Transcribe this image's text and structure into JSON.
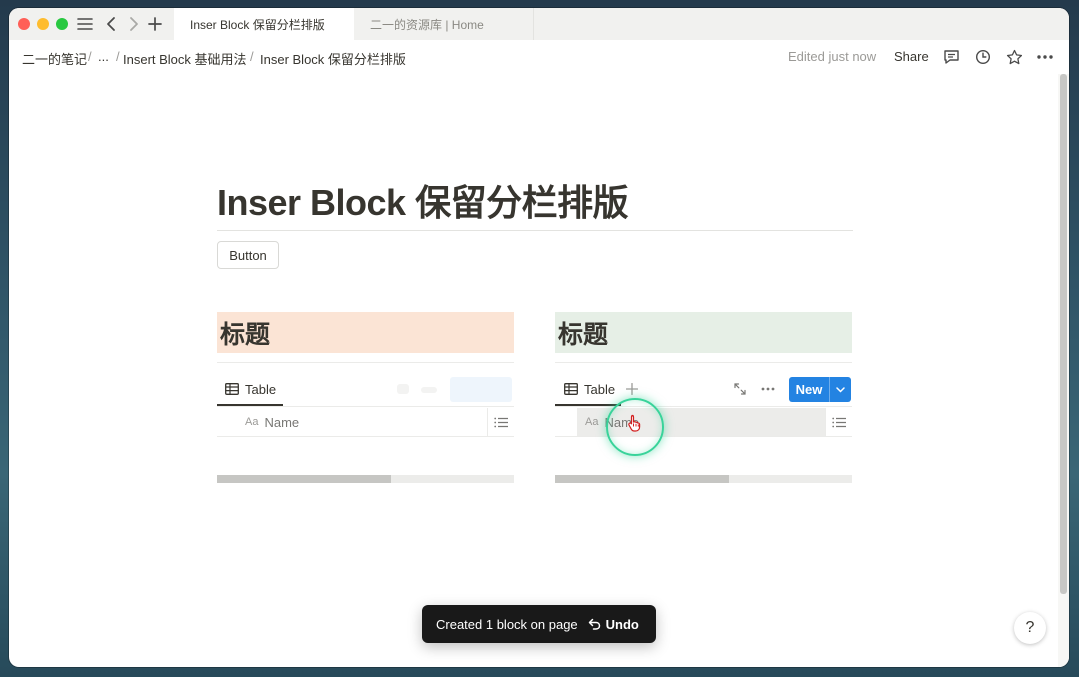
{
  "window": {
    "tabs": [
      {
        "label": "Inser Block 保留分栏排版",
        "active": true
      },
      {
        "label": "二一的资源库 | Home",
        "active": false
      }
    ]
  },
  "topbar": {
    "breadcrumbs": [
      "二一的笔记",
      "...",
      "Insert Block 基础用法",
      "Inser Block 保留分栏排版"
    ],
    "separator": "/",
    "edited": "Edited just now",
    "share": "Share"
  },
  "page": {
    "title": "Inser Block 保留分栏排版",
    "button_label": "Button",
    "columns": [
      {
        "heading": "标题",
        "heading_color": "#fbe4d5",
        "view_label": "Table",
        "column_type_icon": "Aa",
        "column_name": "Name"
      },
      {
        "heading": "标题",
        "heading_color": "#e6efe6",
        "view_label": "Table",
        "column_type_icon": "Aa",
        "column_name": "Name",
        "new_label": "New"
      }
    ]
  },
  "toast": {
    "message": "Created 1 block on page",
    "undo": "Undo"
  },
  "help": "?",
  "colors": {
    "accent": "#2383e2",
    "click_ring": "#39d39a"
  }
}
